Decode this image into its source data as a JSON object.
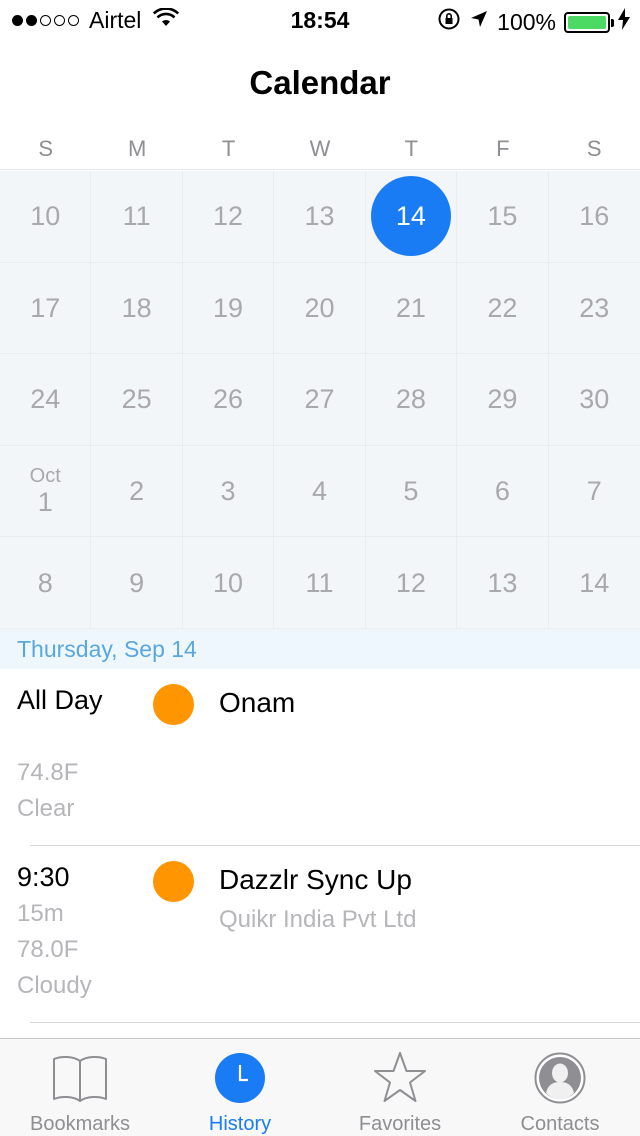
{
  "status_bar": {
    "carrier": "Airtel",
    "time": "18:54",
    "battery_percent": "100%",
    "signal_bars_filled": 2,
    "signal_bars_total": 5,
    "colors": {
      "battery": "#4cd964"
    }
  },
  "nav": {
    "title": "Calendar"
  },
  "calendar": {
    "weekdays": [
      "S",
      "M",
      "T",
      "W",
      "T",
      "F",
      "S"
    ],
    "accent": "#1a7cf5",
    "days": [
      {
        "d": "10"
      },
      {
        "d": "11"
      },
      {
        "d": "12"
      },
      {
        "d": "13"
      },
      {
        "d": "14",
        "today": true
      },
      {
        "d": "15"
      },
      {
        "d": "16"
      },
      {
        "d": "17"
      },
      {
        "d": "18"
      },
      {
        "d": "19"
      },
      {
        "d": "20"
      },
      {
        "d": "21"
      },
      {
        "d": "22"
      },
      {
        "d": "23"
      },
      {
        "d": "24"
      },
      {
        "d": "25"
      },
      {
        "d": "26"
      },
      {
        "d": "27"
      },
      {
        "d": "28"
      },
      {
        "d": "29"
      },
      {
        "d": "30"
      },
      {
        "d": "1",
        "month": "Oct"
      },
      {
        "d": "2"
      },
      {
        "d": "3"
      },
      {
        "d": "4"
      },
      {
        "d": "5"
      },
      {
        "d": "6"
      },
      {
        "d": "7"
      },
      {
        "d": "8"
      },
      {
        "d": "9"
      },
      {
        "d": "10"
      },
      {
        "d": "11"
      },
      {
        "d": "12"
      },
      {
        "d": "13"
      },
      {
        "d": "14"
      }
    ]
  },
  "selected_date": "Thursday, Sep 14",
  "events": [
    {
      "time": "All Day",
      "duration": "",
      "temperature": "74.8F",
      "weather": "Clear",
      "title": "Onam",
      "subtitle": "",
      "dot_color": "#ff9500"
    },
    {
      "time": "9:30",
      "duration": "15m",
      "temperature": "78.0F",
      "weather": "Cloudy",
      "title": "Dazzlr Sync Up",
      "subtitle": "Quikr India Pvt Ltd",
      "dot_color": "#ff9500"
    }
  ],
  "tabs": [
    {
      "label": "Bookmarks",
      "icon": "book-icon",
      "active": false
    },
    {
      "label": "History",
      "icon": "clock-icon",
      "active": true
    },
    {
      "label": "Favorites",
      "icon": "star-icon",
      "active": false
    },
    {
      "label": "Contacts",
      "icon": "person-icon",
      "active": false
    }
  ]
}
